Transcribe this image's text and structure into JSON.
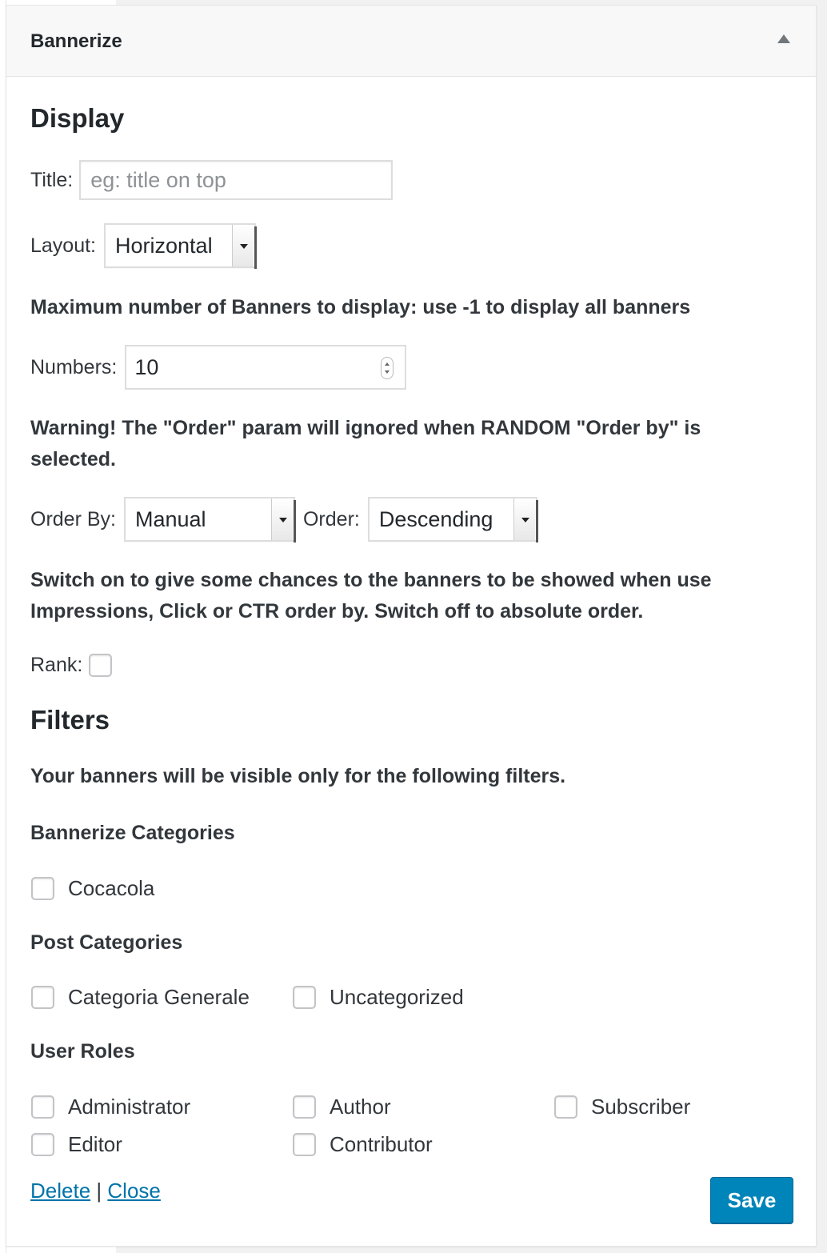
{
  "widget": {
    "title": "Bannerize"
  },
  "display": {
    "heading": "Display",
    "title_label": "Title:",
    "title_value": "",
    "title_placeholder": "eg: title on top",
    "layout_label": "Layout:",
    "layout_value": "Horizontal",
    "max_text": "Maximum number of Banners to display: use -1 to display all banners",
    "numbers_label": "Numbers:",
    "numbers_value": "10",
    "warning_text": "Warning! The \"Order\" param will ignored when RANDOM \"Order by\" is selected.",
    "order_by_label": "Order By:",
    "order_by_value": "Manual",
    "order_label": "Order:",
    "order_value": "Descending",
    "switch_text": "Switch on to give some chances to the banners to be showed when use Impressions, Click or CTR order by. Switch off to absolute order.",
    "rank_label": "Rank:",
    "rank_checked": false
  },
  "filters": {
    "heading": "Filters",
    "intro": "Your banners will be visible only for the following filters.",
    "bannerize_categories_label": "Bannerize Categories",
    "bannerize_categories": [
      "Cocacola"
    ],
    "post_categories_label": "Post Categories",
    "post_categories": [
      "Categoria Generale",
      "Uncategorized"
    ],
    "user_roles_label": "User Roles",
    "user_roles": [
      "Administrator",
      "Author",
      "Subscriber",
      "Editor",
      "Contributor"
    ]
  },
  "footer": {
    "delete_label": "Delete",
    "separator": "|",
    "close_label": "Close",
    "save_label": "Save"
  },
  "colors": {
    "primary": "#0085ba",
    "link": "#0073aa",
    "text": "#23282d"
  }
}
